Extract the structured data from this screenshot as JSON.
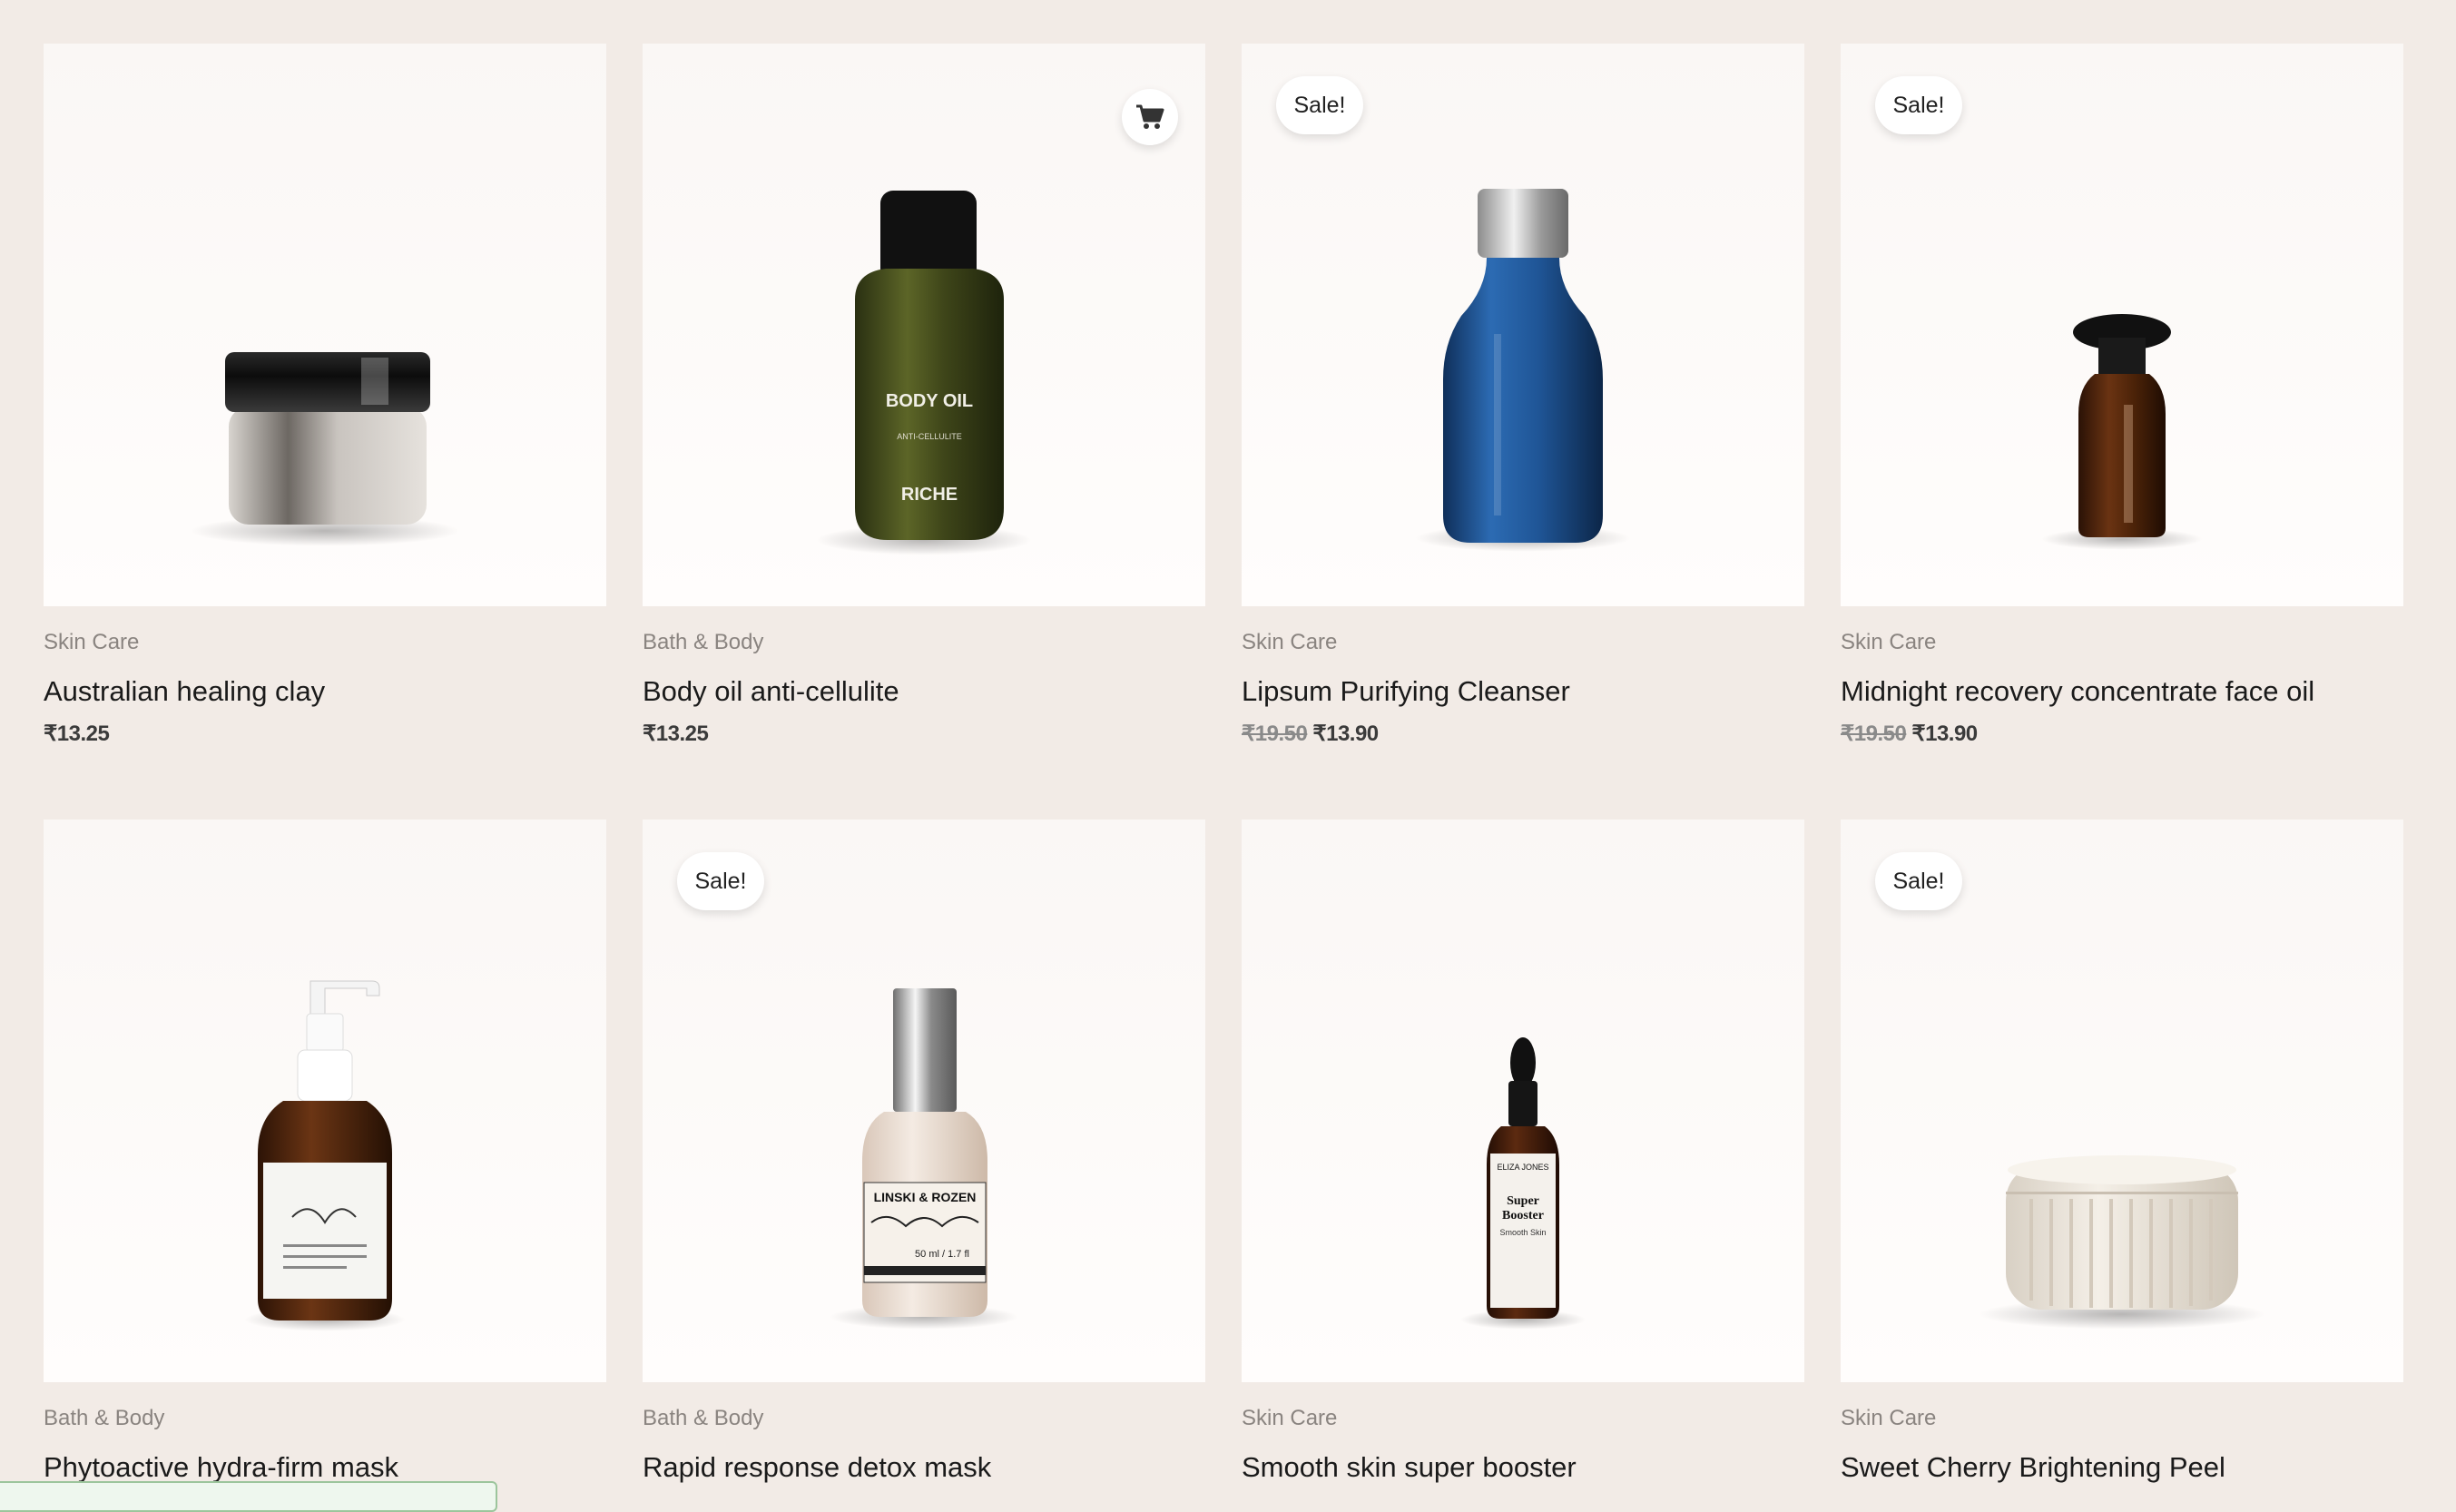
{
  "products": [
    {
      "category": "Skin Care",
      "name": "Australian healing clay",
      "price": "₹13.25",
      "sale_price": "",
      "sale_label": ""
    },
    {
      "category": "Bath & Body",
      "name": "Body oil anti-cellulite",
      "price": "₹13.25",
      "sale_price": "",
      "sale_label": "",
      "bottle_text_1": "BODY OIL",
      "bottle_text_2": "ANTI-CELLULITE",
      "bottle_text_3": "RICHE"
    },
    {
      "category": "Skin Care",
      "name": "Lipsum Purifying Cleanser",
      "price": "₹19.50",
      "sale_price": "₹13.90",
      "sale_label": "Sale!"
    },
    {
      "category": "Skin Care",
      "name": "Midnight recovery concentrate face oil",
      "price": "₹19.50",
      "sale_price": "₹13.90",
      "sale_label": "Sale!"
    },
    {
      "category": "Bath & Body",
      "name": "Phytoactive hydra-firm mask",
      "sale_label": ""
    },
    {
      "category": "Bath & Body",
      "name": "Rapid response detox mask",
      "sale_label": "Sale!",
      "bottle_text_1": "LINSKI & ROZEN",
      "bottle_text_2": "50 ml / 1.7 fl"
    },
    {
      "category": "Skin Care",
      "name": "Smooth skin super booster",
      "sale_label": "",
      "bottle_text_1": "ELIZA JONES",
      "bottle_text_2": "Super",
      "bottle_text_3": "Booster",
      "bottle_text_4": "Smooth Skin"
    },
    {
      "category": "Skin Care",
      "name": "Sweet Cherry Brightening Peel",
      "sale_label": "Sale!"
    }
  ],
  "cart_icon": "shopping-cart-icon",
  "colors": {
    "page_background": "#f2ebe6",
    "card_background": "#fcfaf8",
    "text_primary": "#1a1a1a",
    "text_muted": "#8a8480"
  }
}
